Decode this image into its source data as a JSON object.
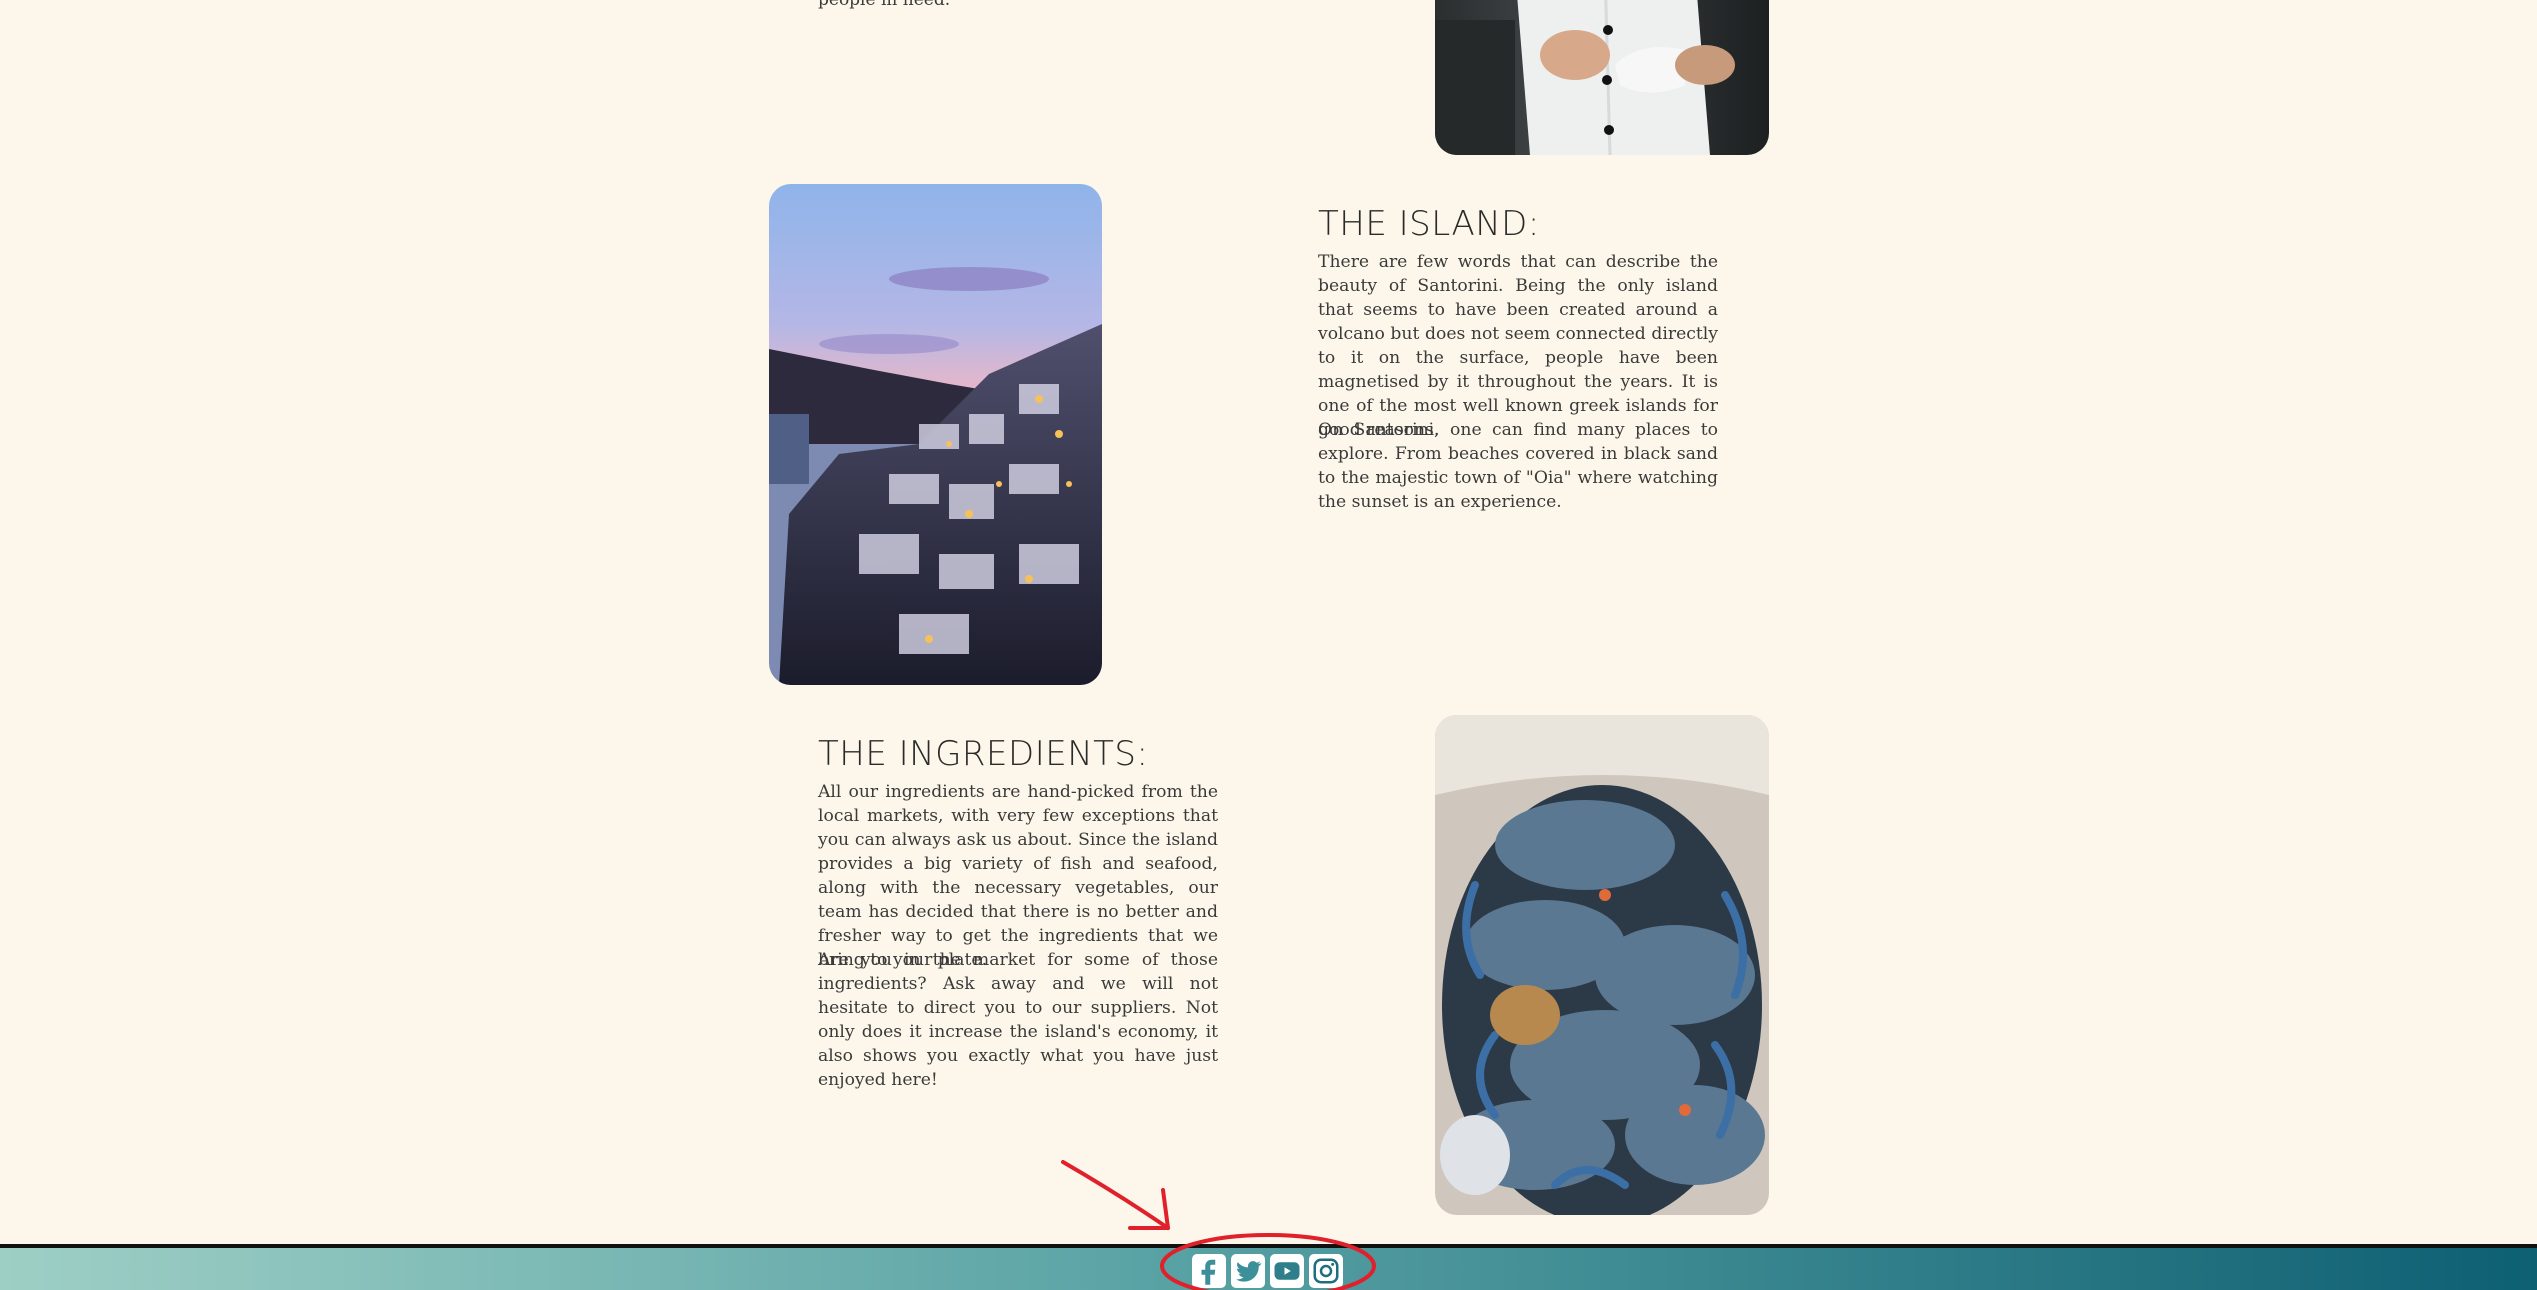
{
  "top_text_fragment": "people in need.",
  "island": {
    "title": "THE ISLAND:",
    "paragraph1": "There are few words that can describe the beauty of Santorini. Being the only island that seems to have been created around a volcano but does not seem connected directly to it on the surface, people have been magnetised by it throughout the years. It is one of the most well known greek islands for good reasons.",
    "paragraph2": "On Santorini, one can find many places to explore. From beaches covered in black sand to the majestic town of \"Oia\" where watching the sunset is an experience."
  },
  "ingredients": {
    "title": "THE INGREDIENTS:",
    "paragraph1": "All our ingredients are hand-picked from the local markets, with very few exceptions that you can always ask us about. Since the island provides a big variety of fish and seafood, along with the necessary vegetables, our team has decided that there is no better and fresher way to get the ingredients that we bring to your plate.",
    "paragraph2": "Are you in the market for some of those ingredients? Ask away and we will not hesitate to direct you to our suppliers. Not only does it increase the island's economy, it also shows you exactly what you have just enjoyed here!"
  },
  "images": {
    "chef": "chef-holding-cup-photo",
    "santorini": "santorini-town-at-dusk-photo",
    "crabs": "blue-crabs-in-basket-photo"
  },
  "social_icons": [
    "facebook-icon",
    "twitter-icon",
    "youtube-icon",
    "instagram-icon"
  ],
  "colors": {
    "background": "#fcf7ea",
    "footer_gradient_start": "#9ecfc5",
    "footer_gradient_end": "#0d5f72",
    "annotation_red": "#e0202a"
  }
}
